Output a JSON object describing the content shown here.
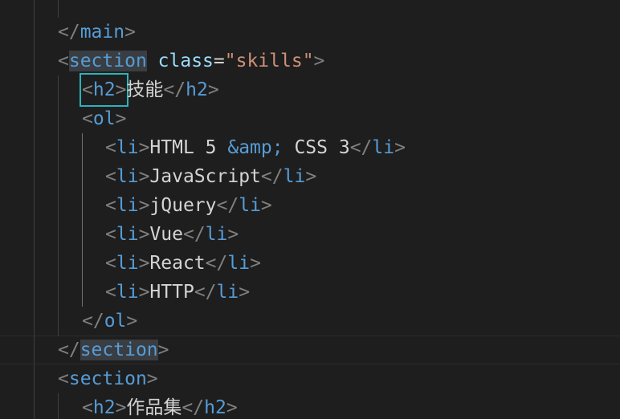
{
  "editor": {
    "lines": [
      {
        "tokens": [
          {
            "text": "</",
            "type": "bracket"
          },
          {
            "text": "main",
            "type": "tag"
          },
          {
            "text": ">",
            "type": "bracket"
          }
        ]
      },
      {
        "tokens": [
          {
            "text": "<",
            "type": "bracket"
          },
          {
            "text": "section",
            "type": "tag",
            "highlight": true
          },
          {
            "text": " ",
            "type": "text"
          },
          {
            "text": "class",
            "type": "attr"
          },
          {
            "text": "=",
            "type": "eq"
          },
          {
            "text": "\"skills\"",
            "type": "str"
          },
          {
            "text": ">",
            "type": "bracket"
          }
        ]
      },
      {
        "tokens": [
          {
            "text": "<h2>",
            "type": "boxed"
          },
          {
            "text": "技能",
            "type": "text"
          },
          {
            "text": "</",
            "type": "bracket"
          },
          {
            "text": "h2",
            "type": "tag"
          },
          {
            "text": ">",
            "type": "bracket"
          }
        ]
      },
      {
        "tokens": [
          {
            "text": "<",
            "type": "bracket"
          },
          {
            "text": "ol",
            "type": "tag"
          },
          {
            "text": ">",
            "type": "bracket"
          }
        ]
      },
      {
        "tokens": [
          {
            "text": "<",
            "type": "bracket"
          },
          {
            "text": "li",
            "type": "tag"
          },
          {
            "text": ">",
            "type": "bracket"
          },
          {
            "text": "HTML 5 ",
            "type": "text"
          },
          {
            "text": "&amp;",
            "type": "entity"
          },
          {
            "text": " CSS 3",
            "type": "text"
          },
          {
            "text": "</",
            "type": "bracket"
          },
          {
            "text": "li",
            "type": "tag"
          },
          {
            "text": ">",
            "type": "bracket"
          }
        ]
      },
      {
        "tokens": [
          {
            "text": "<",
            "type": "bracket"
          },
          {
            "text": "li",
            "type": "tag"
          },
          {
            "text": ">",
            "type": "bracket"
          },
          {
            "text": "JavaScript",
            "type": "text"
          },
          {
            "text": "</",
            "type": "bracket"
          },
          {
            "text": "li",
            "type": "tag"
          },
          {
            "text": ">",
            "type": "bracket"
          }
        ]
      },
      {
        "tokens": [
          {
            "text": "<",
            "type": "bracket"
          },
          {
            "text": "li",
            "type": "tag"
          },
          {
            "text": ">",
            "type": "bracket"
          },
          {
            "text": "jQuery",
            "type": "text"
          },
          {
            "text": "</",
            "type": "bracket"
          },
          {
            "text": "li",
            "type": "tag"
          },
          {
            "text": ">",
            "type": "bracket"
          }
        ]
      },
      {
        "tokens": [
          {
            "text": "<",
            "type": "bracket"
          },
          {
            "text": "li",
            "type": "tag"
          },
          {
            "text": ">",
            "type": "bracket"
          },
          {
            "text": "Vue",
            "type": "text"
          },
          {
            "text": "</",
            "type": "bracket"
          },
          {
            "text": "li",
            "type": "tag"
          },
          {
            "text": ">",
            "type": "bracket"
          }
        ]
      },
      {
        "tokens": [
          {
            "text": "<",
            "type": "bracket"
          },
          {
            "text": "li",
            "type": "tag"
          },
          {
            "text": ">",
            "type": "bracket"
          },
          {
            "text": "React",
            "type": "text"
          },
          {
            "text": "</",
            "type": "bracket"
          },
          {
            "text": "li",
            "type": "tag"
          },
          {
            "text": ">",
            "type": "bracket"
          }
        ]
      },
      {
        "tokens": [
          {
            "text": "<",
            "type": "bracket"
          },
          {
            "text": "li",
            "type": "tag"
          },
          {
            "text": ">",
            "type": "bracket"
          },
          {
            "text": "HTTP",
            "type": "text"
          },
          {
            "text": "</",
            "type": "bracket"
          },
          {
            "text": "li",
            "type": "tag"
          },
          {
            "text": ">",
            "type": "bracket"
          }
        ]
      },
      {
        "tokens": [
          {
            "text": "</",
            "type": "bracket"
          },
          {
            "text": "ol",
            "type": "tag"
          },
          {
            "text": ">",
            "type": "bracket"
          }
        ]
      },
      {
        "tokens": [
          {
            "text": "</",
            "type": "bracket"
          },
          {
            "text": "section",
            "type": "tag",
            "highlight": true
          },
          {
            "text": ">",
            "type": "bracket"
          }
        ]
      },
      {
        "tokens": [
          {
            "text": "<",
            "type": "bracket"
          },
          {
            "text": "section",
            "type": "tag"
          },
          {
            "text": ">",
            "type": "bracket"
          }
        ]
      },
      {
        "tokens": [
          {
            "text": "<",
            "type": "bracket"
          },
          {
            "text": "h2",
            "type": "tag"
          },
          {
            "text": ">",
            "type": "bracket"
          },
          {
            "text": "作品集",
            "type": "text"
          },
          {
            "text": "</",
            "type": "bracket"
          },
          {
            "text": "h2",
            "type": "tag"
          },
          {
            "text": ">",
            "type": "bracket"
          }
        ]
      }
    ]
  },
  "colors": {
    "background": "#1e1e1e",
    "tag": "#569cd6",
    "attribute": "#9cdcfe",
    "string": "#ce9178",
    "bracket": "#808080",
    "text": "#d4d4d4",
    "bracket_match_box": "#2ab3bd",
    "word_highlight": "#3a3d41"
  }
}
